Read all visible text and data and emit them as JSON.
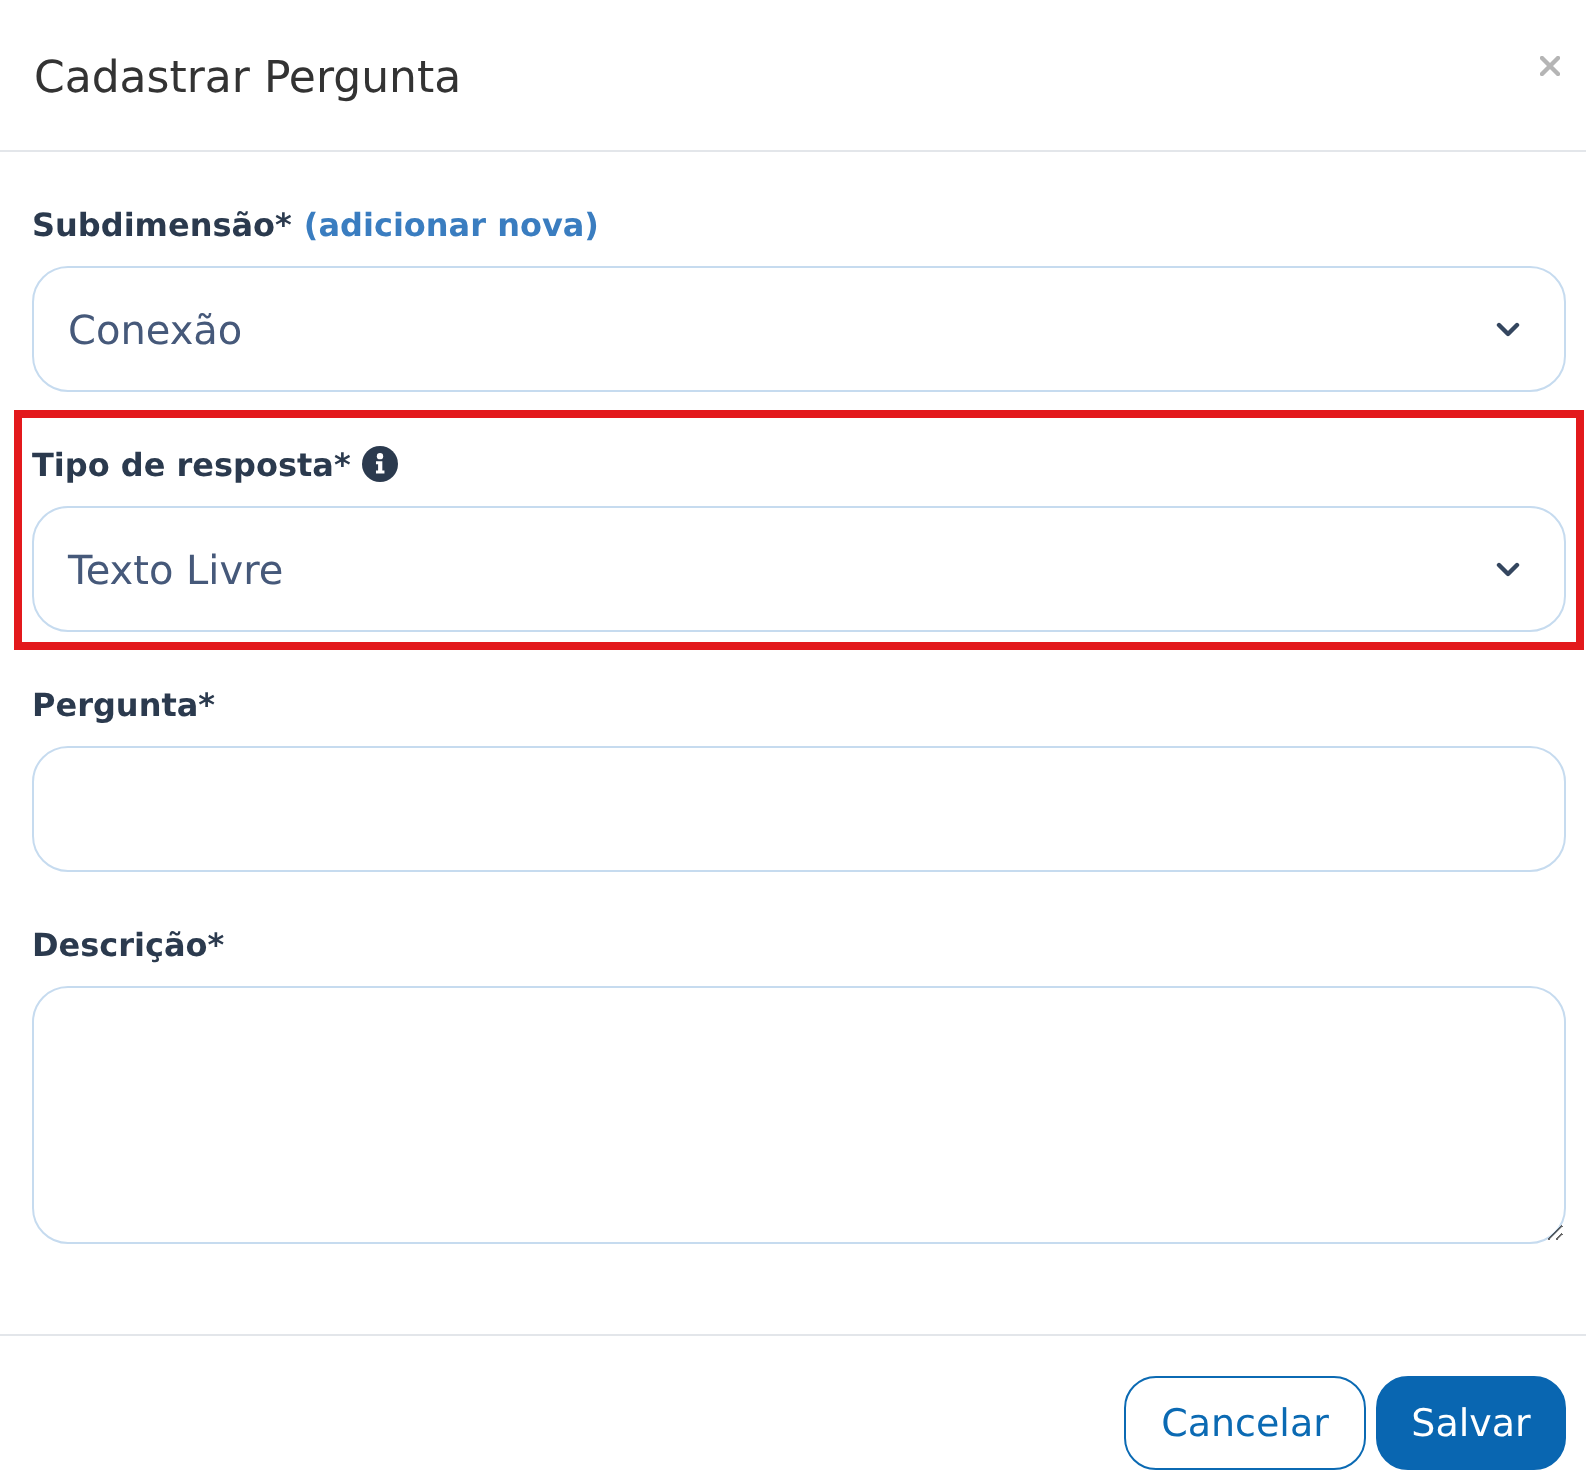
{
  "dialog": {
    "title": "Cadastrar Pergunta"
  },
  "fields": [
    {
      "kind": "select",
      "label": "Subdimensão*",
      "link": "(adicionar nova)",
      "info": false,
      "value": "Conexão",
      "highlighted": false
    },
    {
      "kind": "select",
      "label": "Tipo de resposta*",
      "info": true,
      "value": "Texto Livre",
      "highlighted": true
    },
    {
      "kind": "input",
      "label": "Pergunta*",
      "info": false,
      "highlighted": false
    },
    {
      "kind": "textarea",
      "label": "Descrição*",
      "info": false,
      "highlighted": false
    }
  ],
  "buttons": [
    {
      "kind": "secondary",
      "label": "Cancelar"
    },
    {
      "kind": "primary",
      "label": "Salvar"
    }
  ]
}
